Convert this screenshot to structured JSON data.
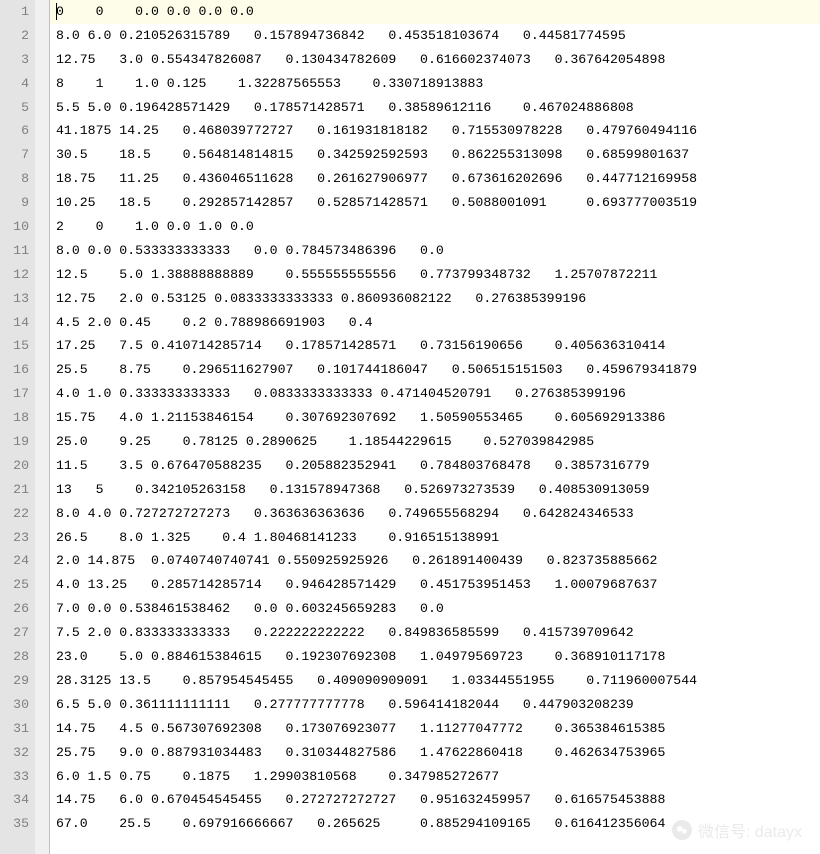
{
  "editor": {
    "highlighted_line": 1,
    "caret_line": 1,
    "lines": [
      "0    0    0.0 0.0 0.0 0.0",
      "8.0 6.0 0.210526315789   0.157894736842   0.453518103674   0.44581774595",
      "12.75   3.0 0.554347826087   0.130434782609   0.616602374073   0.367642054898",
      "8    1    1.0 0.125    1.32287565553    0.330718913883",
      "5.5 5.0 0.196428571429   0.178571428571   0.38589612116    0.467024886808",
      "41.1875 14.25   0.468039772727   0.161931818182   0.715530978228   0.479760494116",
      "30.5    18.5    0.564814814815   0.342592592593   0.862255313098   0.68599801637",
      "18.75   11.25   0.436046511628   0.261627906977   0.673616202696   0.447712169958",
      "10.25   18.5    0.292857142857   0.528571428571   0.5088001091     0.693777003519",
      "2    0    1.0 0.0 1.0 0.0",
      "8.0 0.0 0.533333333333   0.0 0.784573486396   0.0",
      "12.5    5.0 1.38888888889    0.555555555556   0.773799348732   1.25707872211",
      "12.75   2.0 0.53125 0.0833333333333 0.860936082122   0.276385399196",
      "4.5 2.0 0.45    0.2 0.788986691903   0.4",
      "17.25   7.5 0.410714285714   0.178571428571   0.73156190656    0.405636310414",
      "25.5    8.75    0.296511627907   0.101744186047   0.506515151503   0.459679341879",
      "4.0 1.0 0.333333333333   0.0833333333333 0.471404520791   0.276385399196",
      "15.75   4.0 1.21153846154    0.307692307692   1.50590553465    0.605692913386",
      "25.0    9.25    0.78125 0.2890625    1.18544229615    0.527039842985",
      "11.5    3.5 0.676470588235   0.205882352941   0.784803768478   0.3857316779",
      "13   5    0.342105263158   0.131578947368   0.526973273539   0.408530913059",
      "8.0 4.0 0.727272727273   0.363636363636   0.749655568294   0.642824346533",
      "26.5    8.0 1.325    0.4 1.80468141233    0.916515138991",
      "2.0 14.875  0.0740740740741 0.550925925926   0.261891400439   0.823735885662",
      "4.0 13.25   0.285714285714   0.946428571429   0.451753951453   1.00079687637",
      "7.0 0.0 0.538461538462   0.0 0.603245659283   0.0",
      "7.5 2.0 0.833333333333   0.222222222222   0.849836585599   0.415739709642",
      "23.0    5.0 0.884615384615   0.192307692308   1.04979569723    0.368910117178",
      "28.3125 13.5    0.857954545455   0.409090909091   1.03344551955    0.711960007544",
      "6.5 5.0 0.361111111111   0.277777777778   0.596414182044   0.447903208239",
      "14.75   4.5 0.567307692308   0.173076923077   1.11277047772    0.365384615385",
      "25.75   9.0 0.887931034483   0.310344827586   1.47622860418    0.462634753965",
      "6.0 1.5 0.75    0.1875   1.29903810568    0.347985272677",
      "14.75   6.0 0.670454545455   0.272727272727   0.951632459957   0.616575453888",
      "67.0    25.5    0.697916666667   0.265625     0.885294109165   0.616412356064"
    ]
  },
  "watermark": {
    "text": "微信号: datayx"
  }
}
